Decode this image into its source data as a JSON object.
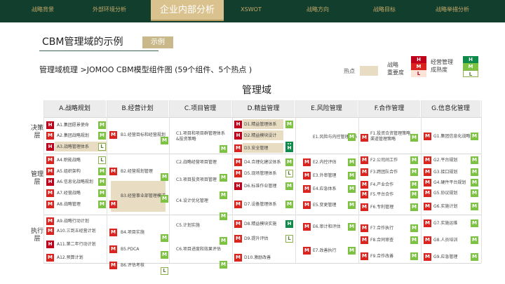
{
  "nav": {
    "items": [
      "战略背景",
      "外部环境分析",
      "XSWOT",
      "战略方向",
      "战略目标",
      "战略举措分析"
    ],
    "active": "企业内部分析"
  },
  "title": "CBM管理域的示例",
  "badge": "示例",
  "subtitle": "管理域梳理 >JOMOO CBM模型组件图 (59个组件、5个热点 )",
  "legend": {
    "hot_label": "热点",
    "strategy_label": "战略\n重要度",
    "mgmt_label": "经营管理\n成熟度",
    "strategy_tags": [
      "H",
      "M",
      "L"
    ],
    "mgmt_tags": [
      "H",
      "M",
      "L"
    ]
  },
  "grid_title": "管理域",
  "layers": [
    "决策层",
    "管理层",
    "执行层"
  ],
  "columns": [
    "A.战略规划",
    "B.经营计划",
    "C.项目管理",
    "D.精益管理",
    "E.风险管理",
    "F.合作管理",
    "G.信息化管理"
  ],
  "cells": {
    "A": [
      "A1.集团愿景使命",
      "A2.集团战略规划",
      "A3.战略管理体系",
      "A4.职能战略",
      "A5.组织架构",
      "A6.信息化战略规划",
      "A7.经营战略",
      "A8.战略管理",
      "A9.战略行动计划",
      "A10.三到五经营计划",
      "A11.第二年行动计划",
      "A12.预算计划"
    ],
    "B": [
      "B1.经营目标和经营规划",
      "B2.经营规划管理",
      "B3.经营事业部管理模式",
      "B4.项目实施",
      "B5.PDCA",
      "B6.评估考核"
    ],
    "C": [
      "C1.项目和项目群管理体系&投资策略",
      "C2.战略经营项目管理",
      "C3.项目投资项目管理",
      "C4.设计优化管理",
      "C5.计划实施",
      "C6.项目进度和效果评估"
    ],
    "D": [
      "D1.精益管理体系",
      "D2.精益模块设计",
      "D3.安全管理",
      "D4.合理化建议体系",
      "D5.现场管理体系",
      "D6.标准作业管理",
      "D7.设备管理体系",
      "D8.精益模块实施",
      "D9.提升评估",
      "D10.激励改善"
    ],
    "E": [
      "E1.风险与内控管理体系",
      "E2.内控评估",
      "E3.外审管理",
      "E4.应急体系",
      "E5.变更管理",
      "E6.审计和评估",
      "E7.改善执行"
    ],
    "F": [
      "F1.投资合资管理策略渠道管理策略",
      "F2.公司间工作",
      "F3.跨团队合作",
      "F4.产业合作",
      "F5.平台合作",
      "F6.专利管理",
      "F7.合作执行",
      "F8.合同审查",
      "F9.合作改善"
    ],
    "G": [
      "G1.集团信息化战略规划",
      "G2.平台规划",
      "G3.接口规划",
      "G4.硬件平台规划",
      "G5.协议规划",
      "G6.实施计划",
      "G7.实施运维",
      "G8.人员培训",
      "G9.应急管理"
    ]
  }
}
